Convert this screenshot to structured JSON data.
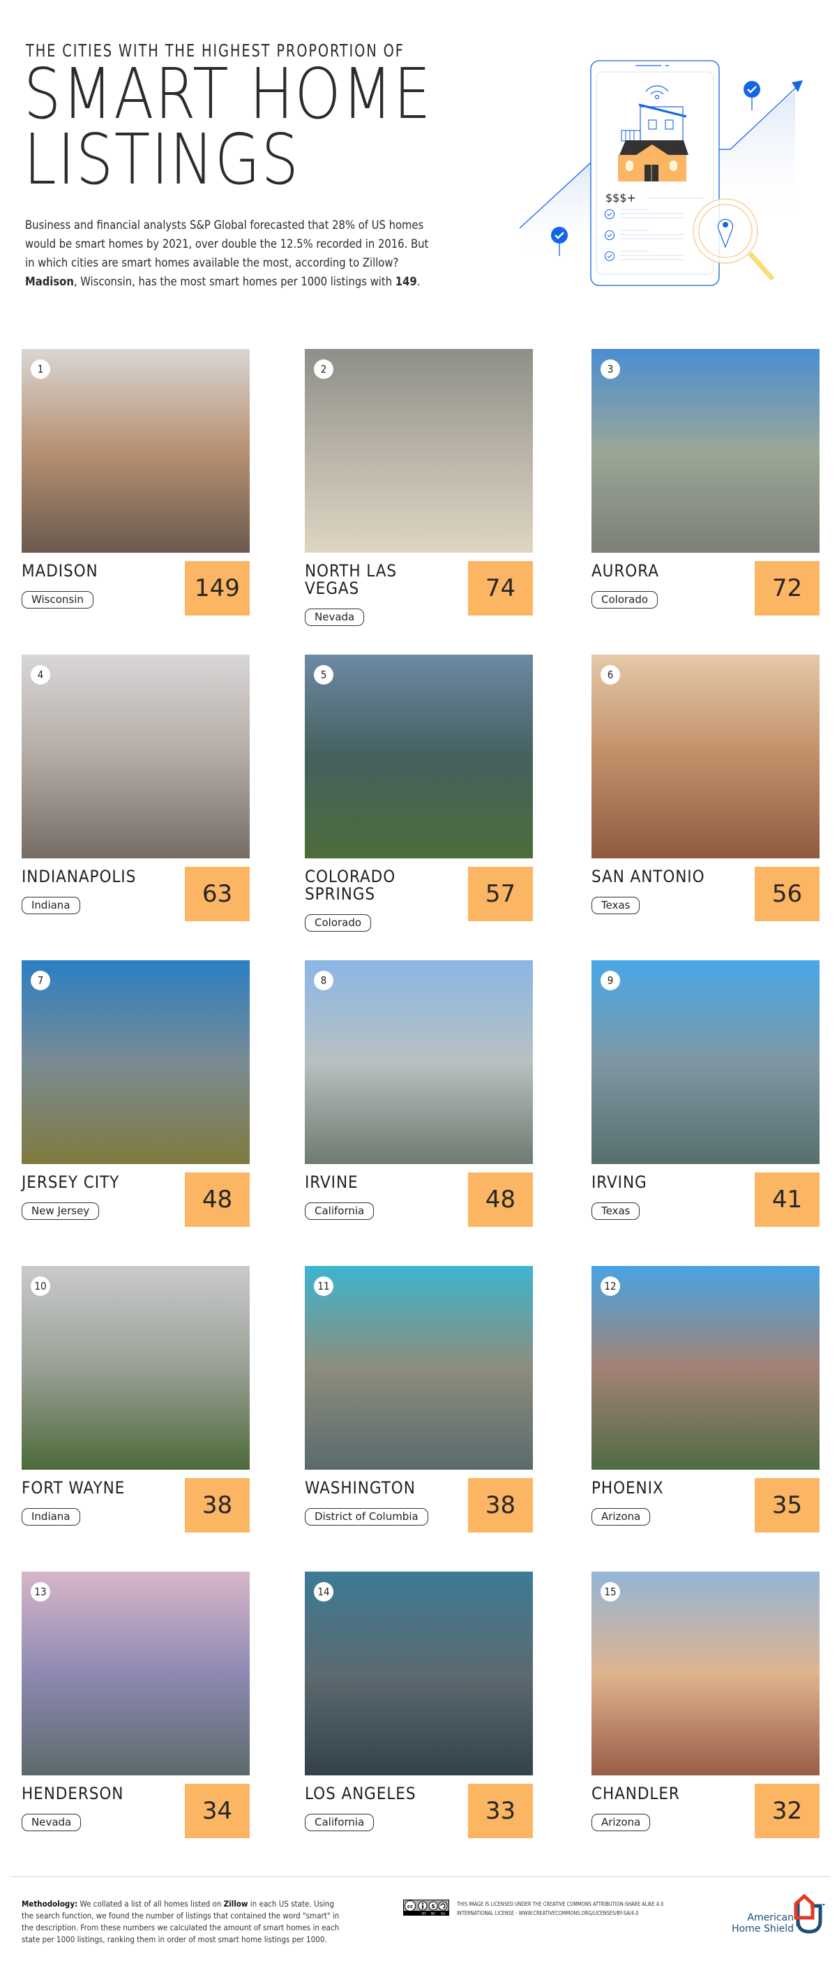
{
  "header": {
    "subtitle": "THE CITIES WITH THE HIGHEST PROPORTION OF",
    "title_line1": "SMART HOME",
    "title_line2": "LISTINGS",
    "intro_line1": "Business and financial analysts S&P Global forecasted that 28% of US homes",
    "intro_line2": "would be smart homes by 2021, over double the 12.5% recorded in 2016. But",
    "intro_line3": "in which cities are smart homes available the most, according to Zillow?",
    "intro_bold_city": "Madison",
    "intro_line4_mid": ", Wisconsin, has the most smart homes per 1000 listings with ",
    "intro_bold_value": "149",
    "intro_line4_end": "."
  },
  "illustration": {
    "price_label": "$$$+",
    "icons": [
      "smartphone-icon",
      "house-icon",
      "wifi-icon",
      "checkmark-pin-icon",
      "magnifier-location-icon",
      "growth-arrow-icon"
    ]
  },
  "colors": {
    "score_box": "#fbb563",
    "accent_blue": "#1565e8",
    "text": "#222222",
    "logo_blue": "#1a4f7a",
    "logo_red": "#e03a24"
  },
  "cities": [
    {
      "rank": "1",
      "city": "Madison",
      "state": "Wisconsin",
      "score": "149"
    },
    {
      "rank": "2",
      "city": "North Las Vegas",
      "state": "Nevada",
      "score": "74"
    },
    {
      "rank": "3",
      "city": "Aurora",
      "state": "Colorado",
      "score": "72"
    },
    {
      "rank": "4",
      "city": "Indianapolis",
      "state": "Indiana",
      "score": "63"
    },
    {
      "rank": "5",
      "city": "Colorado Springs",
      "state": "Colorado",
      "score": "57"
    },
    {
      "rank": "6",
      "city": "San Antonio",
      "state": "Texas",
      "score": "56"
    },
    {
      "rank": "7",
      "city": "Jersey City",
      "state": "New Jersey",
      "score": "48"
    },
    {
      "rank": "8",
      "city": "Irvine",
      "state": "California",
      "score": "48"
    },
    {
      "rank": "9",
      "city": "Irving",
      "state": "Texas",
      "score": "41"
    },
    {
      "rank": "10",
      "city": "Fort Wayne",
      "state": "Indiana",
      "score": "38"
    },
    {
      "rank": "11",
      "city": "Washington",
      "state": "District of Columbia",
      "score": "38"
    },
    {
      "rank": "12",
      "city": "Phoenix",
      "state": "Arizona",
      "score": "35"
    },
    {
      "rank": "13",
      "city": "Henderson",
      "state": "Nevada",
      "score": "34"
    },
    {
      "rank": "14",
      "city": "Los Angeles",
      "state": "California",
      "score": "33"
    },
    {
      "rank": "15",
      "city": "Chandler",
      "state": "Arizona",
      "score": "32"
    }
  ],
  "footer": {
    "methodology_label": "Methodology:",
    "methodology_part1": " We collated a list of all homes listed on ",
    "methodology_zillow": "Zillow",
    "methodology_part2": " in each US state. Using the search function, we found the number of listings that contained the word \"smart\" in the description. From these numbers we calculated the amount of smart homes in each state per 1000 listings, ranking them in order of most smart home listings per 1000.",
    "license_line1": "This image is licensed under the Creative Commons Attribution-Share Alike 4.0",
    "license_line2": "International License - www.creativecommons.org/licenses/by-sa/4.0",
    "cc_labels": [
      "BY",
      "NC",
      "SA"
    ],
    "logo_line1": "American",
    "logo_line2": "Home Shield"
  }
}
